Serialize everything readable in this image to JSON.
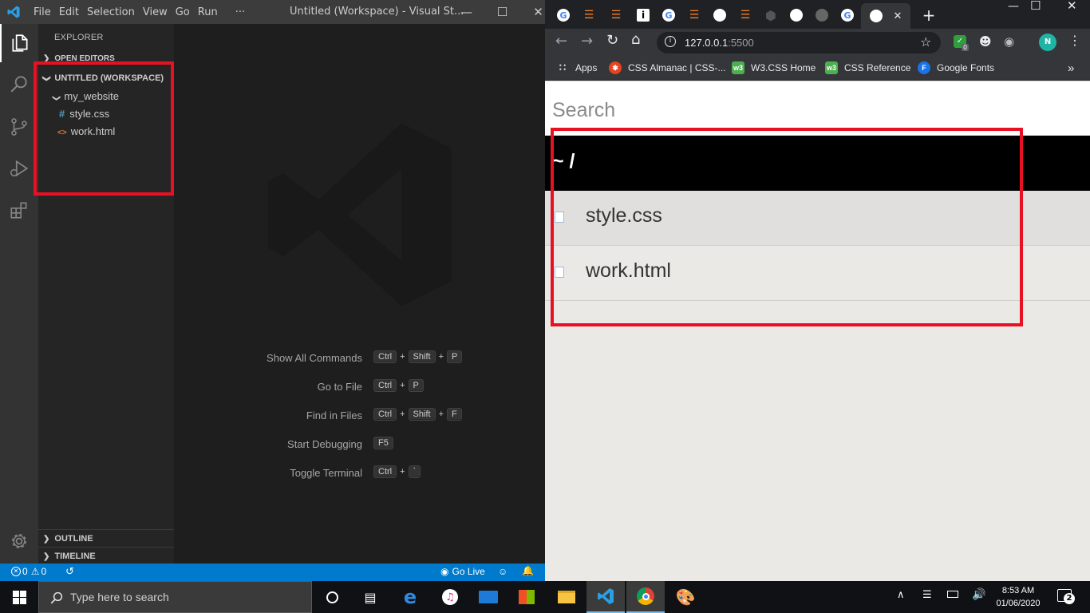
{
  "vscode": {
    "menu": [
      "File",
      "Edit",
      "Selection",
      "View",
      "Go",
      "Run",
      "···"
    ],
    "window_title": "Untitled (Workspace) - Visual St...",
    "explorer_title": "EXPLORER",
    "open_editors": "OPEN EDITORS",
    "workspace": "UNTITLED (WORKSPACE)",
    "folder": "my_website",
    "files": [
      {
        "name": "style.css",
        "icon": "#",
        "icon_color": "#519aba"
      },
      {
        "name": "work.html",
        "icon": "<>",
        "icon_color": "#e37933"
      }
    ],
    "outline": "OUTLINE",
    "timeline": "TIMELINE",
    "shortcuts": [
      {
        "label": "Show All Commands",
        "keys": [
          "Ctrl",
          "Shift",
          "P"
        ]
      },
      {
        "label": "Go to File",
        "keys": [
          "Ctrl",
          "P"
        ]
      },
      {
        "label": "Find in Files",
        "keys": [
          "Ctrl",
          "Shift",
          "F"
        ]
      },
      {
        "label": "Start Debugging",
        "keys": [
          "F5"
        ]
      },
      {
        "label": "Toggle Terminal",
        "keys": [
          "Ctrl",
          "`"
        ]
      }
    ],
    "status": {
      "errors": "0",
      "warnings": "0",
      "go_live": "Go Live"
    },
    "accent": "#007acc"
  },
  "chrome": {
    "url_host": "127.0.0.1",
    "url_port": ":5500",
    "bookmarks": [
      {
        "label": "Apps",
        "color": "#e0e0e0"
      },
      {
        "label": "CSS Almanac | CSS-...",
        "color": "#e8421f"
      },
      {
        "label": "W3.CSS Home",
        "color": "#4caf50"
      },
      {
        "label": "CSS Reference",
        "color": "#4caf50"
      },
      {
        "label": "Google Fonts",
        "color": "#1a73e8"
      }
    ],
    "extension_badge": "0"
  },
  "page": {
    "search_placeholder": "Search",
    "path": "~ /",
    "files": [
      "style.css",
      "work.html"
    ]
  },
  "taskbar": {
    "search_placeholder": "Type here to search",
    "time": "8:53 AM",
    "date": "01/06/2020",
    "notifications": "2"
  }
}
